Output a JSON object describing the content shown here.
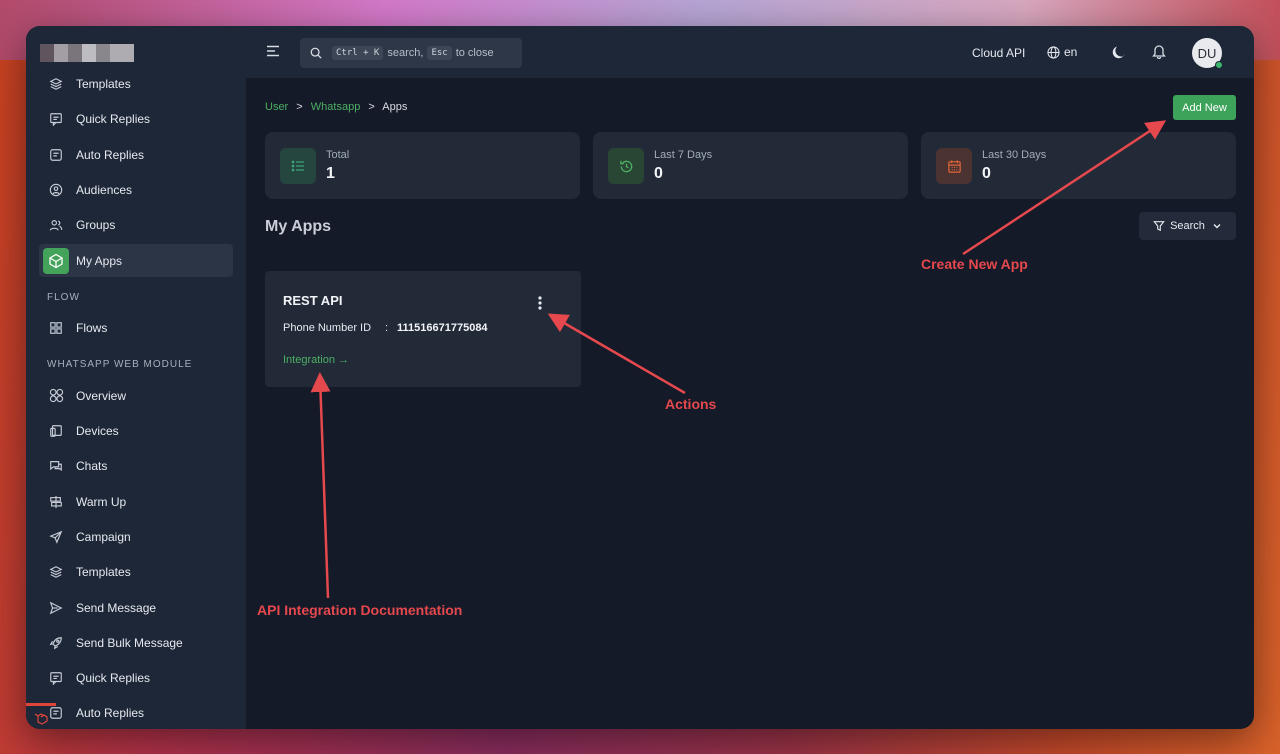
{
  "header": {
    "search_hint_kbd1": "Ctrl + K",
    "search_hint_mid": "search,",
    "search_hint_kbd2": "Esc",
    "search_hint_end": "to close",
    "cloud_api": "Cloud API",
    "language": "en",
    "avatar_initials": "DU"
  },
  "sidebar": {
    "items_top": [
      {
        "label": "Templates",
        "icon": "layers-icon"
      },
      {
        "label": "Quick Replies",
        "icon": "chat-reply-icon"
      },
      {
        "label": "Auto Replies",
        "icon": "message-square-icon"
      },
      {
        "label": "Audiences",
        "icon": "user-circle-icon"
      },
      {
        "label": "Groups",
        "icon": "users-icon"
      },
      {
        "label": "My Apps",
        "icon": "cube-icon",
        "active": true
      }
    ],
    "flow_section": "FLOW",
    "flow_items": [
      {
        "label": "Flows",
        "icon": "grid-icon"
      }
    ],
    "web_section": "WHATSAPP WEB MODULE",
    "web_items": [
      {
        "label": "Overview",
        "icon": "circles-grid-icon"
      },
      {
        "label": "Devices",
        "icon": "devices-icon"
      },
      {
        "label": "Chats",
        "icon": "chats-icon"
      },
      {
        "label": "Warm Up",
        "icon": "signpost-icon"
      },
      {
        "label": "Campaign",
        "icon": "send-arrow-icon"
      },
      {
        "label": "Templates",
        "icon": "layers-icon"
      },
      {
        "label": "Send Message",
        "icon": "send-icon"
      },
      {
        "label": "Send Bulk Message",
        "icon": "rocket-icon"
      },
      {
        "label": "Quick Replies",
        "icon": "chat-reply-icon"
      },
      {
        "label": "Auto Replies",
        "icon": "message-square-icon"
      }
    ]
  },
  "breadcrumb": {
    "user": "User",
    "sep": ">",
    "whatsapp": "Whatsapp",
    "apps": "Apps"
  },
  "actions": {
    "add_new": "Add New",
    "search": "Search"
  },
  "stats": [
    {
      "label": "Total",
      "value": "1",
      "icon": "list-icon",
      "color": "#3fa37a"
    },
    {
      "label": "Last 7 Days",
      "value": "0",
      "icon": "history-icon",
      "color": "#4caf63"
    },
    {
      "label": "Last 30 Days",
      "value": "0",
      "icon": "calendar-icon",
      "color": "#e0653a"
    }
  ],
  "section_title": "My Apps",
  "app_card": {
    "title": "REST API",
    "phone_label": "Phone Number ID",
    "colon": ":",
    "phone_value": "111516671775084",
    "integration": "Integration →"
  },
  "annotations": {
    "create": "Create New App",
    "actions": "Actions",
    "docs": "API Integration Documentation"
  },
  "colors": {
    "accent": "#3da35b",
    "annotation": "#e5484d"
  }
}
